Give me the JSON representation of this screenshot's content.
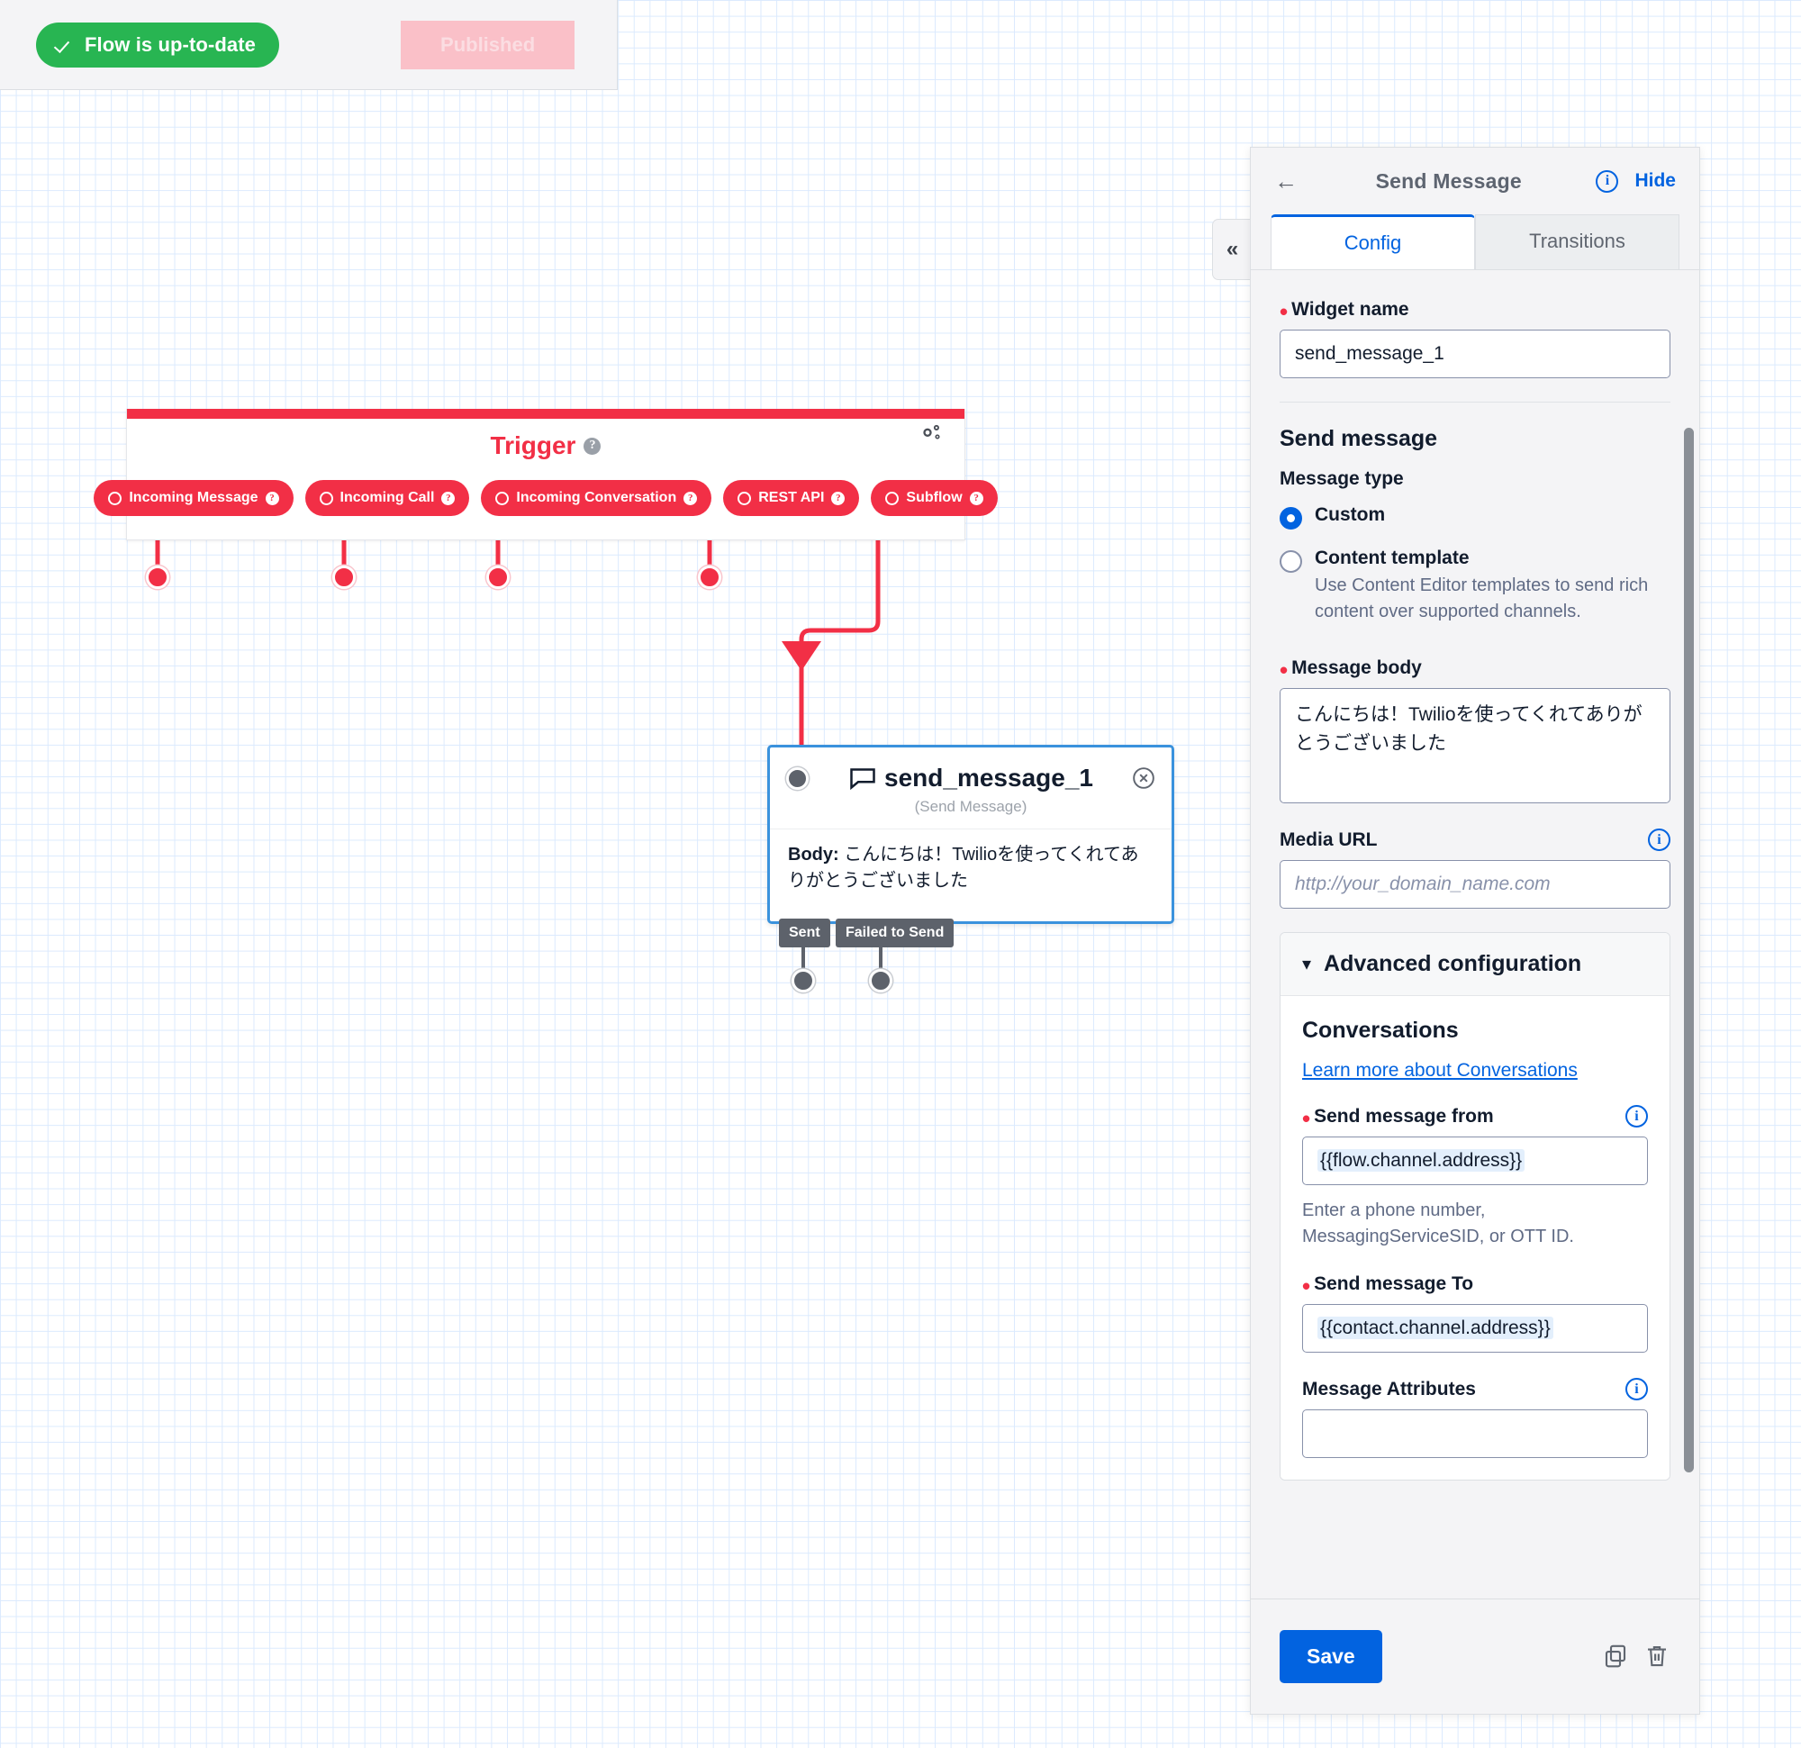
{
  "statusbar": {
    "flow_status": "Flow is up-to-date",
    "publish_state": "Published",
    "check_icon": "check-icon"
  },
  "canvas": {
    "trigger": {
      "title": "Trigger",
      "help_icon": "question-mark-icon",
      "settings_icon": "gears-icon",
      "pills": [
        {
          "label": "Incoming Message"
        },
        {
          "label": "Incoming Call"
        },
        {
          "label": "Incoming Conversation"
        },
        {
          "label": "REST API"
        },
        {
          "label": "Subflow"
        }
      ],
      "accent_color": "#f22f46"
    },
    "send_widget": {
      "title": "send_message_1",
      "type_icon": "chat-bubble-icon",
      "close_icon": "close-circle-icon",
      "subtitle": "(Send Message)",
      "body_label": "Body:",
      "body_text": "こんにちは！Twilioを使ってくれてありがとうございました",
      "outputs": [
        {
          "label": "Sent"
        },
        {
          "label": "Failed to Send"
        }
      ],
      "border_color": "#3a92dd"
    }
  },
  "panel": {
    "collapse_icon": "chevron-double-left-icon",
    "back_icon": "arrow-left-icon",
    "title": "Send Message",
    "info_icon": "info-icon",
    "hide_label": "Hide",
    "tabs": [
      {
        "label": "Config",
        "active": true
      },
      {
        "label": "Transitions",
        "active": false
      }
    ],
    "widget_name": {
      "label": "Widget name",
      "value": "send_message_1",
      "required": true
    },
    "send_message": {
      "heading": "Send message",
      "message_type_label": "Message type",
      "options": [
        {
          "label": "Custom",
          "selected": true,
          "help": ""
        },
        {
          "label": "Content template",
          "selected": false,
          "help": "Use Content Editor templates to send rich content over supported channels."
        }
      ]
    },
    "message_body": {
      "label": "Message body",
      "required": true,
      "value": "こんにちは！Twilioを使ってくれてありがとうございました"
    },
    "media_url": {
      "label": "Media URL",
      "info_icon": "info-icon",
      "placeholder": "http://your_domain_name.com",
      "value": ""
    },
    "advanced": {
      "heading": "Advanced configuration",
      "chevron_icon": "chevron-down-icon",
      "conversations_heading": "Conversations",
      "learn_more_link": "Learn more about Conversations",
      "send_from": {
        "label": "Send message from",
        "required": true,
        "info_icon": "info-icon",
        "value": "{{flow.channel.address}}",
        "help": "Enter a phone number, MessagingServiceSID, or OTT ID."
      },
      "send_to": {
        "label": "Send message To",
        "required": true,
        "value": "{{contact.channel.address}}"
      },
      "message_attributes": {
        "label": "Message Attributes",
        "info_icon": "info-icon",
        "value": ""
      }
    },
    "footer": {
      "save_label": "Save",
      "copy_icon": "copy-icon",
      "delete_icon": "trash-icon"
    },
    "accent_color": "#0263e0"
  }
}
